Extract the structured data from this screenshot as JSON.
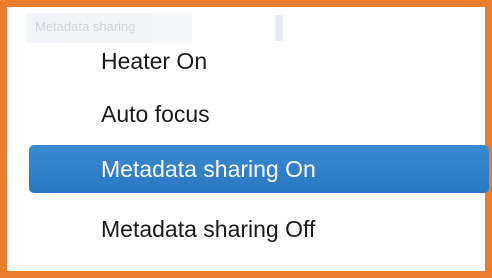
{
  "background": {
    "faded_label": "Metadata sharing"
  },
  "menu": {
    "items": [
      {
        "label": "Heater On",
        "selected": false
      },
      {
        "label": "Auto focus",
        "selected": false
      },
      {
        "label": "Metadata sharing On",
        "selected": true
      },
      {
        "label": "Metadata sharing Off",
        "selected": false
      }
    ]
  },
  "colors": {
    "frame_border": "#ec7c2e",
    "selection_bg": "#2a77c3",
    "selection_text": "#ffffff",
    "item_text": "#1a1a1a"
  }
}
